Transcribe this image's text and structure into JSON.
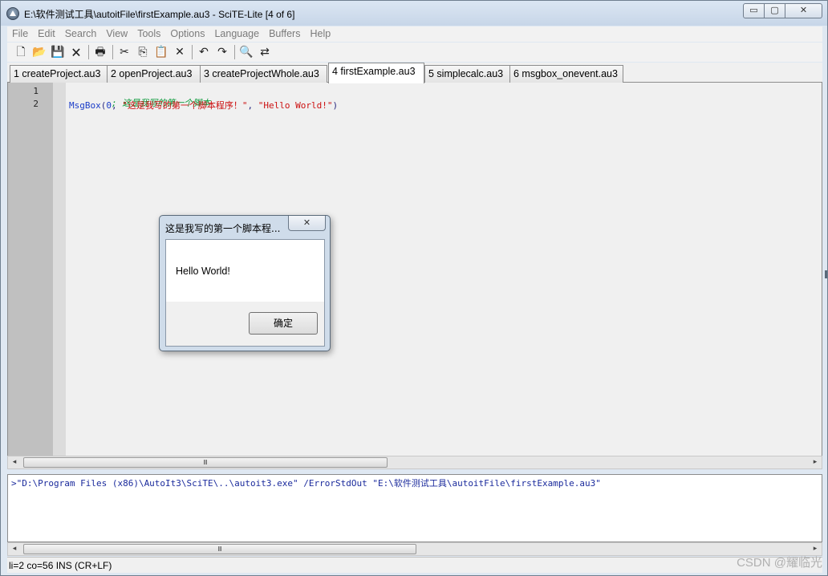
{
  "window": {
    "title": "E:\\软件测试工具\\autoitFile\\firstExample.au3 - SciTE-Lite [4 of 6]",
    "minimize_glyph": "▭",
    "maximize_glyph": "▢",
    "close_glyph": "✕"
  },
  "menu": [
    "File",
    "Edit",
    "Search",
    "View",
    "Tools",
    "Options",
    "Language",
    "Buffers",
    "Help"
  ],
  "toolbar": [
    {
      "name": "new-file-icon",
      "glyph": "🗋"
    },
    {
      "name": "open-folder-icon",
      "glyph": "📂"
    },
    {
      "name": "save-icon",
      "glyph": "💾"
    },
    {
      "name": "close-file-icon",
      "glyph": "🗙"
    },
    {
      "name": "print-icon",
      "glyph": "🖶"
    },
    {
      "name": "cut-icon",
      "glyph": "✂"
    },
    {
      "name": "copy-icon",
      "glyph": "⎘"
    },
    {
      "name": "paste-icon",
      "glyph": "📋"
    },
    {
      "name": "delete-icon",
      "glyph": "✕"
    },
    {
      "name": "undo-icon",
      "glyph": "↶"
    },
    {
      "name": "redo-icon",
      "glyph": "↷"
    },
    {
      "name": "find-icon",
      "glyph": "🔍"
    },
    {
      "name": "replace-icon",
      "glyph": "⇄"
    }
  ],
  "tabs": [
    {
      "label": "1 createProject.au3",
      "active": false
    },
    {
      "label": "2 openProject.au3",
      "active": false
    },
    {
      "label": "3 createProjectWhole.au3",
      "active": false
    },
    {
      "label": "4 firstExample.au3",
      "active": true
    },
    {
      "label": "5 simplecalc.au3",
      "active": false
    },
    {
      "label": "6 msgbox_onevent.au3",
      "active": false
    }
  ],
  "editor": {
    "line_numbers": [
      "1",
      "2"
    ],
    "line1": {
      "comment": "; 这是我写的第一个脚本"
    },
    "line2": {
      "func": "MsgBox",
      "open": "(",
      "arg1": "0",
      "sep1": ", ",
      "arg2": "\"这是我写的第一个脚本程序！\"",
      "sep2": ", ",
      "arg3": "\"Hello World!\"",
      "close": ")"
    }
  },
  "scroll": {
    "left_arrow": "◂",
    "right_arrow": "▸",
    "grip": "Ⅲ"
  },
  "output": {
    "line": ">\"D:\\Program Files (x86)\\AutoIt3\\SciTE\\..\\autoit3.exe\" /ErrorStdOut \"E:\\软件测试工具\\autoitFile\\firstExample.au3\""
  },
  "status": {
    "text": "li=2 co=56 INS (CR+LF)"
  },
  "watermark": "CSDN @耀临光",
  "dialog": {
    "title": "这是我写的第一个脚本程...",
    "close_glyph": "✕",
    "message": "Hello World!",
    "ok_label": "确定"
  },
  "colors": {
    "comment": "#0a9a3a",
    "keyword": "#1a3cc8",
    "string": "#cc1010",
    "output_text": "#1a2a9c"
  }
}
